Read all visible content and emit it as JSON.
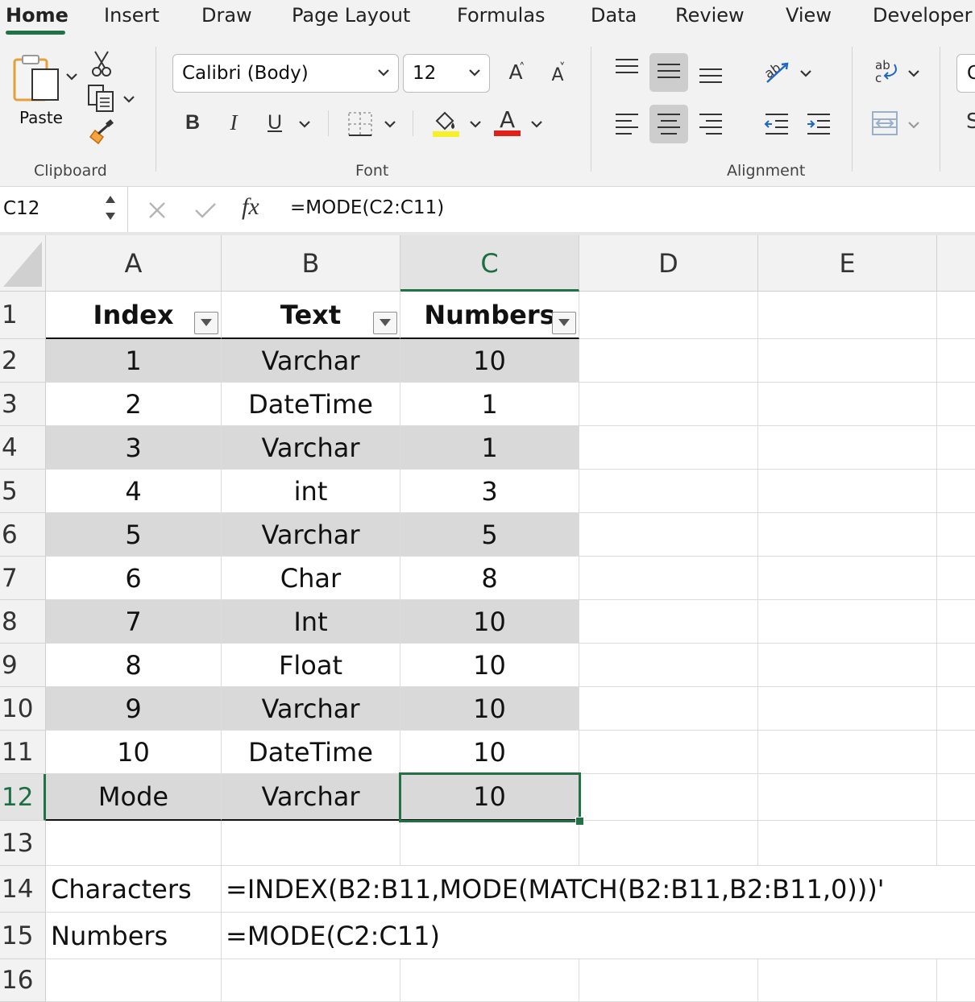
{
  "ribbon": {
    "tabs": [
      "Home",
      "Insert",
      "Draw",
      "Page Layout",
      "Formulas",
      "Data",
      "Review",
      "View",
      "Developer"
    ],
    "active_tab": "Home",
    "groups": {
      "clipboard": "Clipboard",
      "font": "Font",
      "alignment": "Alignment"
    },
    "paste_label": "Paste",
    "font_name": "Calibri (Body)",
    "font_size": "12",
    "bold": "B",
    "italic": "I",
    "underline": "U",
    "grow_font": "A",
    "shrink_font": "A",
    "font_color_glyph": "A",
    "number_format_partial": "G",
    "dollar_partial": "S",
    "accent_color": "#217346",
    "highlight_color": "#f5f028",
    "font_color": "#e0201b"
  },
  "formula_bar": {
    "name_box": "C12",
    "fx": "fx",
    "formula": "=MODE(C2:C11)"
  },
  "sheet": {
    "columns": [
      "A",
      "B",
      "C",
      "D",
      "E"
    ],
    "active_column": "C",
    "rows": [
      "1",
      "2",
      "3",
      "4",
      "5",
      "6",
      "7",
      "8",
      "9",
      "10",
      "11",
      "12",
      "13",
      "14",
      "15",
      "16"
    ],
    "active_row": "12",
    "table_headers": [
      "Index",
      "Text",
      "Numbers"
    ],
    "table_rows": [
      [
        "1",
        "Varchar",
        "10"
      ],
      [
        "2",
        "DateTime",
        "1"
      ],
      [
        "3",
        "Varchar",
        "1"
      ],
      [
        "4",
        "int",
        "3"
      ],
      [
        "5",
        "Varchar",
        "5"
      ],
      [
        "6",
        "Char",
        "8"
      ],
      [
        "7",
        "Int",
        "10"
      ],
      [
        "8",
        "Float",
        "10"
      ],
      [
        "9",
        "Varchar",
        "10"
      ],
      [
        "10",
        "DateTime",
        "10"
      ]
    ],
    "total_row": [
      "Mode",
      "Varchar",
      "10"
    ],
    "notes": [
      [
        "Characters",
        "=INDEX(B2:B11,MODE(MATCH(B2:B11,B2:B11,0)))'"
      ],
      [
        "Numbers",
        "=MODE(C2:C11)"
      ]
    ]
  }
}
